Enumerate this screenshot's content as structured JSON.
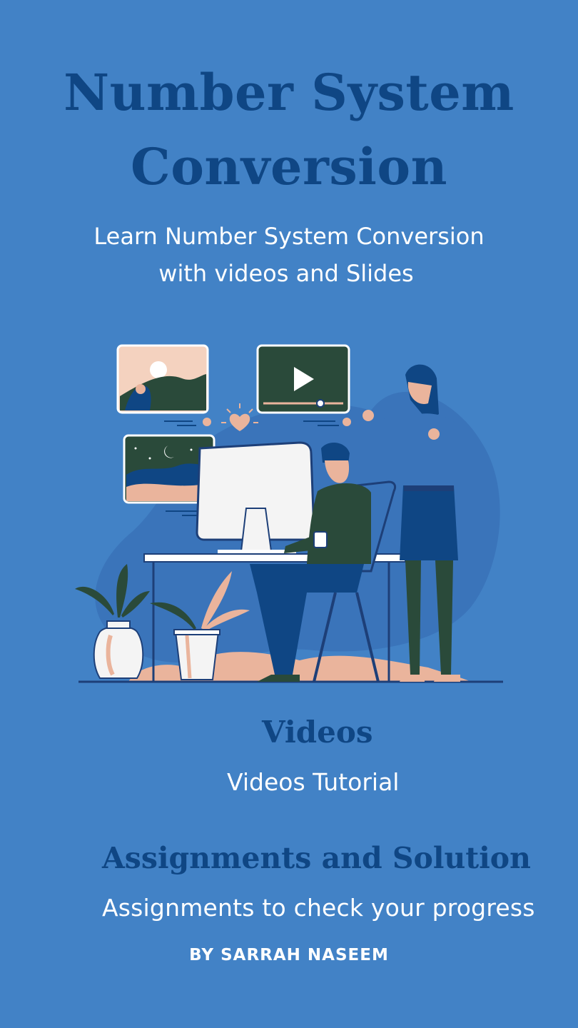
{
  "title": {
    "line1": "Number System",
    "line2": "Conversion"
  },
  "subtitle": {
    "line1": "Learn Number System Conversion",
    "line2": "with videos and Slides"
  },
  "illustration": {
    "name": "online-learning-illustration"
  },
  "sections": {
    "videos": {
      "heading": "Videos",
      "text": "Videos Tutorial"
    },
    "assignments": {
      "heading": "Assignments and Solution",
      "text": "Assignments to check your progress"
    }
  },
  "author": "BY SARRAH NASEEM",
  "colors": {
    "background": "#4282c6",
    "heading": "#0f4684",
    "text": "#ffffff",
    "dark_green": "#2a4a3a",
    "peach": "#eab49c"
  }
}
